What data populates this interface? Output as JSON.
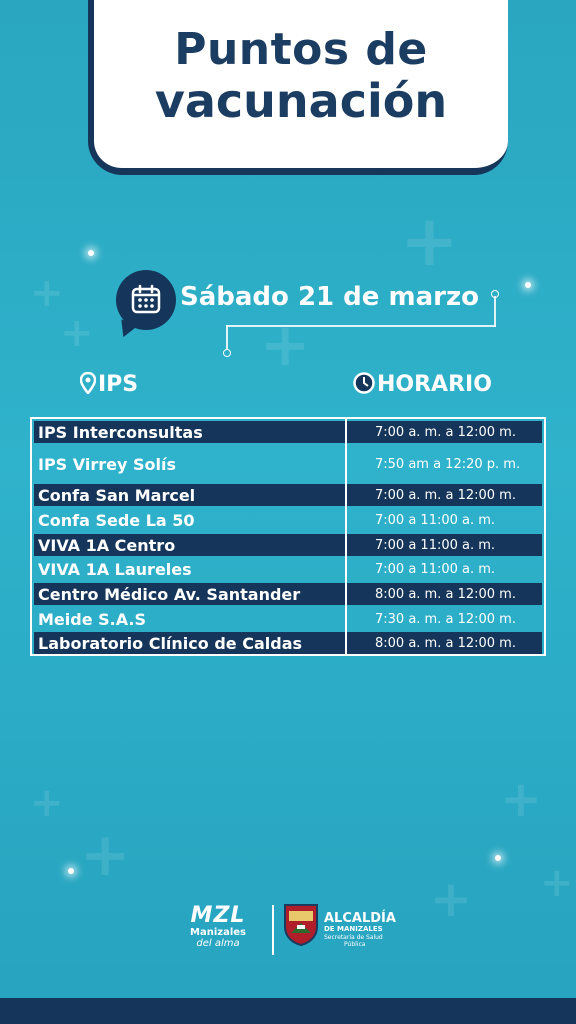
{
  "title": {
    "line1": "Puntos de",
    "line2": "vacunación"
  },
  "date": "Sábado 21 de marzo",
  "headers": {
    "ips": "IPS",
    "horario": "HORARIO"
  },
  "rows": [
    {
      "name": "IPS Interconsultas",
      "time": "7:00 a. m. a 12:00 m."
    },
    {
      "name": "IPS Virrey Solís",
      "time": "7:50 am a 12:20 p. m."
    },
    {
      "name": "Confa San Marcel",
      "time": "7:00 a. m. a 12:00 m."
    },
    {
      "name": "Confa Sede La 50",
      "time": "7:00 a 11:00 a. m."
    },
    {
      "name": "VIVA 1A Centro",
      "time": "7:00 a 11:00 a. m."
    },
    {
      "name": "VIVA 1A Laureles",
      "time": "7:00 a 11:00 a. m."
    },
    {
      "name": "Centro Médico Av. Santander",
      "time": "8:00 a. m. a 12:00 m."
    },
    {
      "name": "Meide S.A.S",
      "time": "7:30 a. m. a 12:00 m."
    },
    {
      "name": "Laboratorio Clínico de Caldas",
      "time": "8:00 a. m. a 12:00 m."
    }
  ],
  "footer": {
    "mzl": "MZL",
    "manizales": "Manizales",
    "del_alma": "del alma",
    "alcaldia": "ALCALDÍA",
    "de_manizales": "DE MANIZALES",
    "secretaria": "Secretaría de Salud",
    "publica": "Pública"
  },
  "colors": {
    "background": "#2fb2cb",
    "navy": "#15365a",
    "white": "#ffffff"
  }
}
